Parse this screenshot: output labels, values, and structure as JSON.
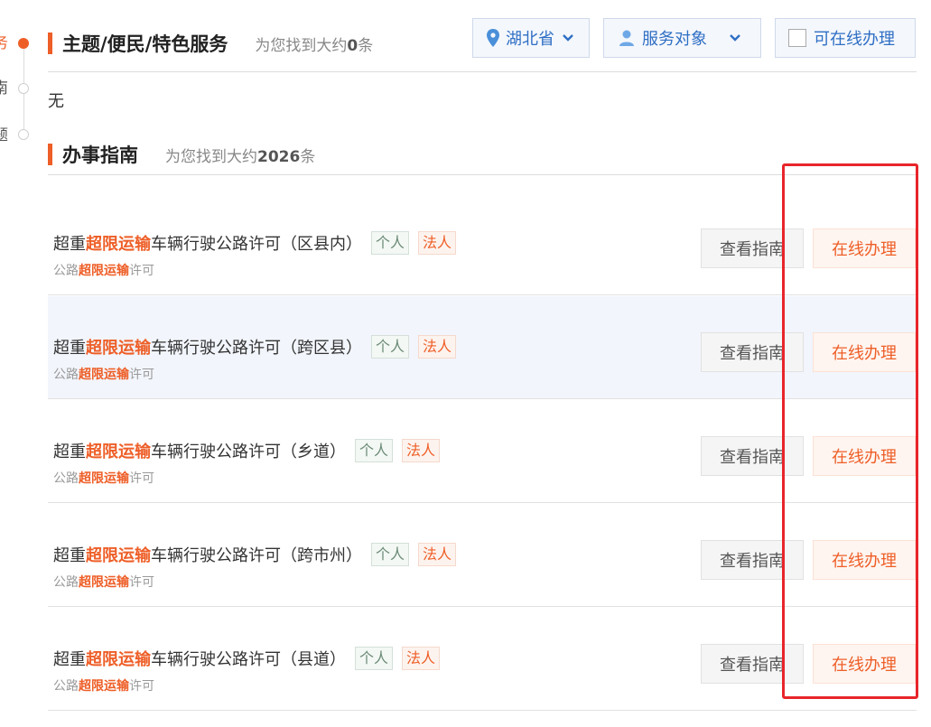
{
  "nav": {
    "items": [
      {
        "label": "务",
        "active": true
      },
      {
        "label": "南",
        "active": false
      },
      {
        "label": "题",
        "active": false
      }
    ]
  },
  "theme_section": {
    "title": "主题/便民/特色服务",
    "count_prefix": "为您找到大约",
    "count": "0",
    "count_suffix": "条",
    "empty_text": "无"
  },
  "filters": {
    "region": {
      "label": "湖北省",
      "icon": "location-pin-icon"
    },
    "audience": {
      "label": "服务对象",
      "icon": "user-icon"
    },
    "online_only": {
      "label": "可在线办理",
      "checked": false
    }
  },
  "guide_section": {
    "title": "办事指南",
    "count_prefix": "为您找到大约",
    "count": "2026",
    "count_suffix": "条"
  },
  "items": [
    {
      "prefix": "超重",
      "keyword": "超限运输",
      "suffix": "车辆行驶公路许可（区县内）",
      "tag_person": "个人",
      "tag_legal": "法人",
      "sub_prefix": "公路",
      "sub_keyword": "超限运输",
      "sub_suffix": "许可",
      "guide_label": "查看指南",
      "online_label": "在线办理",
      "highlighted": false
    },
    {
      "prefix": "超重",
      "keyword": "超限运输",
      "suffix": "车辆行驶公路许可（跨区县）",
      "tag_person": "个人",
      "tag_legal": "法人",
      "sub_prefix": "公路",
      "sub_keyword": "超限运输",
      "sub_suffix": "许可",
      "guide_label": "查看指南",
      "online_label": "在线办理",
      "highlighted": true
    },
    {
      "prefix": "超重",
      "keyword": "超限运输",
      "suffix": "车辆行驶公路许可（乡道）",
      "tag_person": "个人",
      "tag_legal": "法人",
      "sub_prefix": "公路",
      "sub_keyword": "超限运输",
      "sub_suffix": "许可",
      "guide_label": "查看指南",
      "online_label": "在线办理",
      "highlighted": false
    },
    {
      "prefix": "超重",
      "keyword": "超限运输",
      "suffix": "车辆行驶公路许可（跨市州）",
      "tag_person": "个人",
      "tag_legal": "法人",
      "sub_prefix": "公路",
      "sub_keyword": "超限运输",
      "sub_suffix": "许可",
      "guide_label": "查看指南",
      "online_label": "在线办理",
      "highlighted": false
    },
    {
      "prefix": "超重",
      "keyword": "超限运输",
      "suffix": "车辆行驶公路许可（县道）",
      "tag_person": "个人",
      "tag_legal": "法人",
      "sub_prefix": "公路",
      "sub_keyword": "超限运输",
      "sub_suffix": "许可",
      "guide_label": "查看指南",
      "online_label": "在线办理",
      "highlighted": false
    }
  ],
  "colors": {
    "accent": "#ee5e27",
    "link_blue": "#2f6fc4",
    "annotation_red": "#e8252a"
  }
}
